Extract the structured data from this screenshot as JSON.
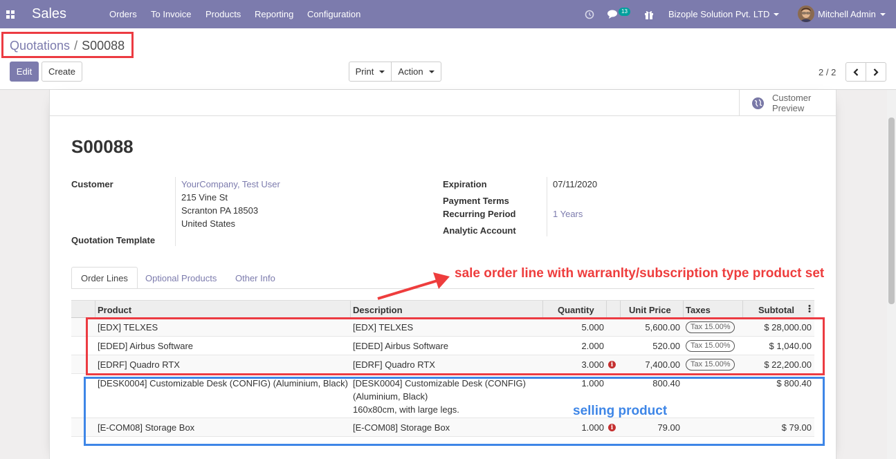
{
  "navbar": {
    "app_name": "Sales",
    "menus": [
      "Orders",
      "To Invoice",
      "Products",
      "Reporting",
      "Configuration"
    ],
    "messages_count": "13",
    "company": "Bizople Solution Pvt. LTD",
    "user": "Mitchell Admin",
    "bg_color": "#7c7bad"
  },
  "breadcrumb": {
    "parent": "Quotations",
    "separator": "/",
    "current": "S00088"
  },
  "toolbar": {
    "edit_label": "Edit",
    "create_label": "Create",
    "print_label": "Print",
    "action_label": "Action"
  },
  "pager": {
    "text": "2 / 2"
  },
  "preview": {
    "line1": "Customer",
    "line2": "Preview"
  },
  "form": {
    "title": "S00088",
    "customer_label": "Customer",
    "customer_name": "YourCompany, Test User",
    "address": [
      "215 Vine St",
      "Scranton PA 18503",
      "United States"
    ],
    "quotation_template_label": "Quotation Template",
    "expiration_label": "Expiration",
    "expiration_value": "07/11/2020",
    "payment_terms_label": "Payment Terms",
    "recurring_period_label": "Recurring Period",
    "recurring_period_value": "1 Years",
    "analytic_account_label": "Analytic Account"
  },
  "tabs": [
    "Order Lines",
    "Optional Products",
    "Other Info"
  ],
  "table": {
    "headers": {
      "product": "Product",
      "description": "Description",
      "quantity": "Quantity",
      "unit_price": "Unit Price",
      "taxes": "Taxes",
      "subtotal": "Subtotal"
    },
    "rows": [
      {
        "product": "[EDX] TELXES",
        "description": [
          "[EDX] TELXES"
        ],
        "quantity": "5.000",
        "unit_price": "5,600.00",
        "tax": "Tax 15.00%",
        "subtotal": "$ 28,000.00",
        "warning": false
      },
      {
        "product": "[EDED] Airbus Software",
        "description": [
          "[EDED] Airbus Software"
        ],
        "quantity": "2.000",
        "unit_price": "520.00",
        "tax": "Tax 15.00%",
        "subtotal": "$ 1,040.00",
        "warning": false
      },
      {
        "product": "[EDRF] Quadro RTX",
        "description": [
          "[EDRF] Quadro RTX"
        ],
        "quantity": "3.000",
        "unit_price": "7,400.00",
        "tax": "Tax 15.00%",
        "subtotal": "$ 22,200.00",
        "warning": true
      },
      {
        "product": "[DESK0004] Customizable Desk (CONFIG) (Aluminium, Black)",
        "description": [
          "[DESK0004] Customizable Desk (CONFIG)",
          "(Aluminium, Black)",
          "160x80cm, with large legs."
        ],
        "quantity": "1.000",
        "unit_price": "800.40",
        "tax": "",
        "subtotal": "$ 800.40",
        "warning": false
      },
      {
        "product": "[E-COM08] Storage Box",
        "description": [
          "[E-COM08] Storage Box"
        ],
        "quantity": "1.000",
        "unit_price": "79.00",
        "tax": "",
        "subtotal": "$ 79.00",
        "warning": true
      }
    ]
  },
  "annotations": {
    "red_text": "sale order line with warranlty/subscription type product set",
    "blue_text": "selling product",
    "red_color": "#ec3b42",
    "blue_color": "#3e86e7"
  }
}
